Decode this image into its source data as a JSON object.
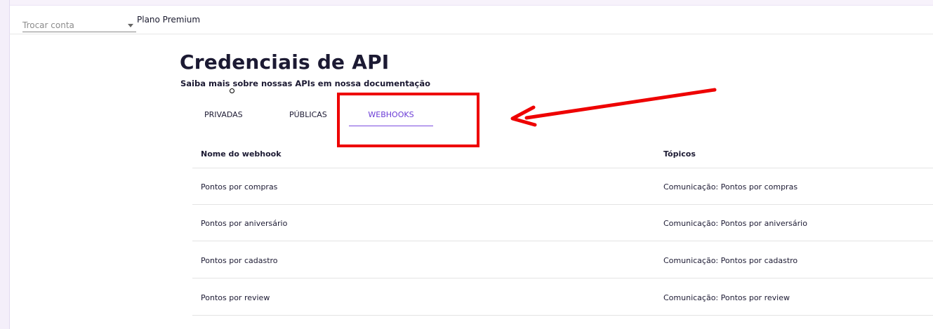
{
  "header": {
    "account_placeholder": "Trocar conta",
    "plan": "Plano Premium"
  },
  "page": {
    "title": "Credenciais de API",
    "subtitle": "Saiba mais sobre nossas APIs em nossa documentação"
  },
  "tabs": [
    {
      "label": "PRIVADAS",
      "active": false
    },
    {
      "label": "PÚBLICAS",
      "active": false
    },
    {
      "label": "WEBHOOKS",
      "active": true
    }
  ],
  "table": {
    "columns": [
      "Nome do webhook",
      "Tópicos"
    ],
    "rows": [
      [
        "Pontos por compras",
        "Comunicação: Pontos por compras"
      ],
      [
        "Pontos por aniversário",
        "Comunicação: Pontos por aniversário"
      ],
      [
        "Pontos por cadastro",
        "Comunicação: Pontos por cadastro"
      ],
      [
        "Pontos por review",
        "Comunicação: Pontos por review"
      ]
    ]
  },
  "annotation": {
    "highlight_color": "#ee0000",
    "arrow_color": "#ee0000"
  },
  "colors": {
    "accent": "#6a3bd6",
    "text": "#1c1a33"
  }
}
